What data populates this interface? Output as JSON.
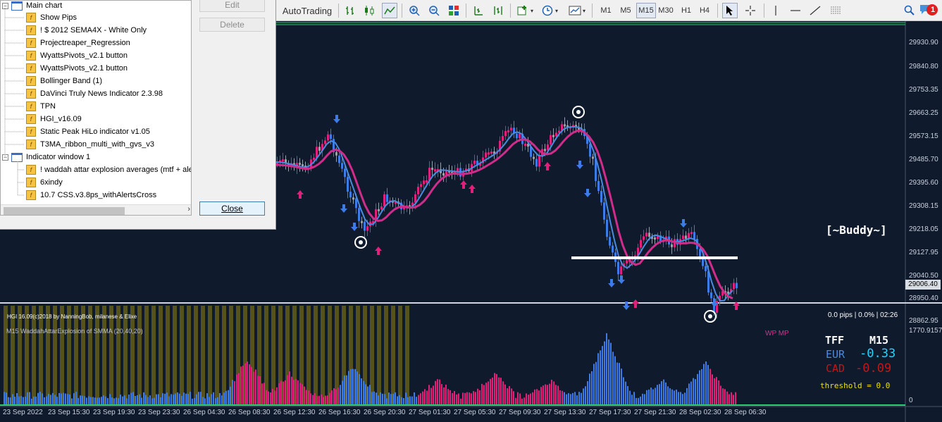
{
  "toolbar": {
    "autotrading_label": "AutoTrading",
    "timeframes": [
      "M1",
      "M5",
      "M15",
      "M30",
      "H1",
      "H4"
    ],
    "active_timeframe": "M15",
    "notification_count": "1"
  },
  "dialog": {
    "tree": {
      "main_chart_label": "Main chart",
      "main_chart_items": [
        "Show Pips",
        "! $ 2012 SEMA4X - White Only",
        "Projectreaper_Regression",
        "WyattsPivots_v2.1 button",
        "WyattsPivots_v2.1 button",
        "Bollinger Band (1)",
        "DaVinci Truly News Indicator 2.3.98",
        "TPN",
        "HGI_v16.09",
        "Static Peak HiLo indicator v1.05",
        "T3MA_ribbon_multi_with_gvs_v3"
      ],
      "indicator_window_label": "Indicator window 1",
      "indicator_window_items": [
        "! waddah attar explosion averages (mtf + ale",
        "6xindy",
        "10.7 CSS.v3.8ps_withAlertsCross"
      ]
    },
    "buttons": {
      "edit": "Edit",
      "delete": "Delete",
      "close": "Close"
    }
  },
  "chart": {
    "price_axis": [
      "29930.90",
      "29840.80",
      "29753.35",
      "29663.25",
      "29573.15",
      "29485.70",
      "29395.60",
      "29308.15",
      "29218.05",
      "29127.95",
      "29040.50",
      "29006.40",
      "28950.40",
      "28862.95"
    ],
    "current_price": "29006.40",
    "buddy_label": "[~Buddy~]",
    "hgi_credit": "HGI 16.09(c)2018 by NanningBob, milanese & Elixe",
    "status": "0.0 pips | 0.0% | 02:26"
  },
  "subwindow": {
    "title": "M15 WaddahAttarExplosion of SMMA (20,40,20)",
    "wp_mp": "WP MP",
    "tf_label": "TFF",
    "tf_value": "M15",
    "eur_label": "EUR",
    "eur_value": "-0.33",
    "cad_label": "CAD",
    "cad_value": "-0.09",
    "threshold": "threshold = 0.0",
    "axis_top": "1770.9157",
    "axis_bottom": "0"
  },
  "time_axis": [
    "23 Sep 2022",
    "23 Sep 15:30",
    "23 Sep 19:30",
    "23 Sep 23:30",
    "26 Sep 04:30",
    "26 Sep 08:30",
    "26 Sep 12:30",
    "26 Sep 16:30",
    "26 Sep 20:30",
    "27 Sep 01:30",
    "27 Sep 05:30",
    "27 Sep 09:30",
    "27 Sep 13:30",
    "27 Sep 17:30",
    "27 Sep 21:30",
    "28 Sep 02:30",
    "28 Sep 06:30"
  ],
  "colors": {
    "bg": "#0f1a2c",
    "bull": "#e0207a",
    "bear": "#3d7be6",
    "neutral": "#9aa0a6",
    "ma_blue": "#4a8be0",
    "ma_magenta": "#d02c8c"
  }
}
